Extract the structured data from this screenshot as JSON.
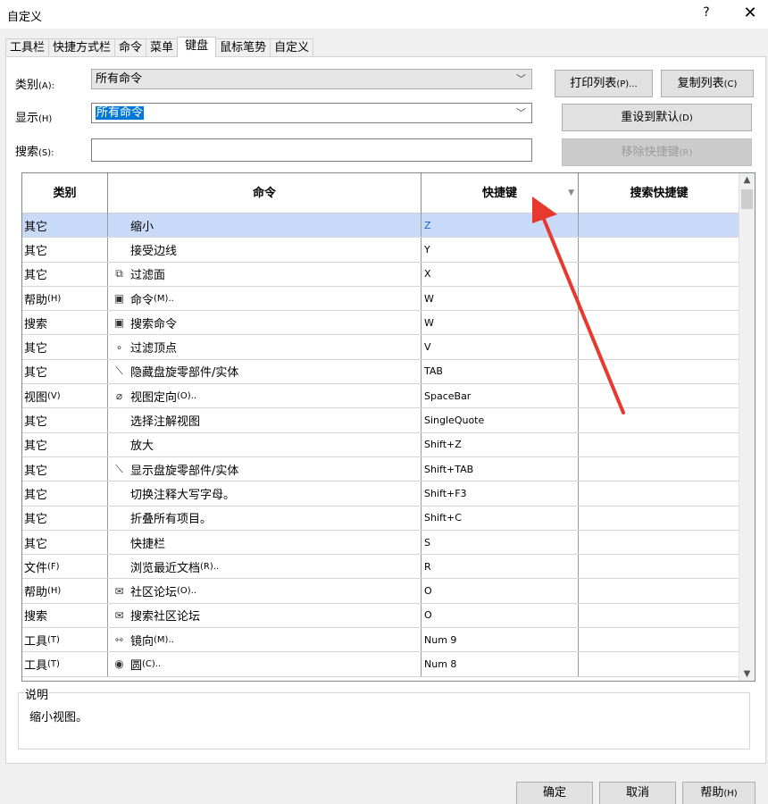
{
  "window": {
    "title": "自定义",
    "help_glyph": "?",
    "close_glyph": "✕"
  },
  "tabs": [
    {
      "label": "工具栏",
      "active": false
    },
    {
      "label": "快捷方式栏",
      "active": false
    },
    {
      "label": "命令",
      "active": false
    },
    {
      "label": "菜单",
      "active": false
    },
    {
      "label": "键盘",
      "active": true
    },
    {
      "label": "鼠标笔势",
      "active": false
    },
    {
      "label": "自定义",
      "active": false
    }
  ],
  "filters": {
    "category_label": "类别",
    "category_key": "(A):",
    "category_value": "所有命令",
    "show_label": "显示",
    "show_key": "(H)",
    "show_value": "所有命令",
    "search_label": "搜索",
    "search_key": "(S):",
    "search_value": ""
  },
  "buttons": {
    "print": {
      "label": "打印列表",
      "key": "(P)..."
    },
    "copy": {
      "label": "复制列表",
      "key": "(C)"
    },
    "reset": {
      "label": "重设到默认",
      "key": "(D)"
    },
    "remove": {
      "label": "移除快捷键",
      "key": "(R)"
    }
  },
  "grid": {
    "columns": [
      "类别",
      "命令",
      "快捷键",
      "搜索快捷键"
    ],
    "rows": [
      {
        "cat": "其它",
        "cat_key": "",
        "icon": "",
        "cmd": "缩小",
        "cmd_key": "",
        "key": "Z",
        "search": ""
      },
      {
        "cat": "其它",
        "cat_key": "",
        "icon": "",
        "cmd": "接受边线",
        "cmd_key": "",
        "key": "Y",
        "search": ""
      },
      {
        "cat": "其它",
        "cat_key": "",
        "icon": "filter-face-icon",
        "cmd": "过滤面",
        "cmd_key": "",
        "key": "X",
        "search": ""
      },
      {
        "cat": "帮助",
        "cat_key": "(H)",
        "icon": "command-box-icon",
        "cmd": "命令",
        "cmd_key": "(M)..",
        "key": "W",
        "search": ""
      },
      {
        "cat": "搜索",
        "cat_key": "",
        "icon": "command-box-icon",
        "cmd": "搜索命令",
        "cmd_key": "",
        "key": "W",
        "search": ""
      },
      {
        "cat": "其它",
        "cat_key": "",
        "icon": "filter-vertex-icon",
        "cmd": "过滤顶点",
        "cmd_key": "",
        "key": "V",
        "search": ""
      },
      {
        "cat": "其它",
        "cat_key": "",
        "icon": "hide-part-icon",
        "cmd": "隐藏盘旋零部件/实体",
        "cmd_key": "",
        "key": "TAB",
        "search": ""
      },
      {
        "cat": "视图",
        "cat_key": "(V)",
        "icon": "view-orient-icon",
        "cmd": "视图定向",
        "cmd_key": "(O)..",
        "key": "SpaceBar",
        "search": ""
      },
      {
        "cat": "其它",
        "cat_key": "",
        "icon": "",
        "cmd": "选择注解视图",
        "cmd_key": "",
        "key": "SingleQuote",
        "search": ""
      },
      {
        "cat": "其它",
        "cat_key": "",
        "icon": "",
        "cmd": "放大",
        "cmd_key": "",
        "key": "Shift+Z",
        "search": ""
      },
      {
        "cat": "其它",
        "cat_key": "",
        "icon": "show-part-icon",
        "cmd": "显示盘旋零部件/实体",
        "cmd_key": "",
        "key": "Shift+TAB",
        "search": ""
      },
      {
        "cat": "其它",
        "cat_key": "",
        "icon": "",
        "cmd": "切换注释大写字母。",
        "cmd_key": "",
        "key": "Shift+F3",
        "search": ""
      },
      {
        "cat": "其它",
        "cat_key": "",
        "icon": "",
        "cmd": "折叠所有项目。",
        "cmd_key": "",
        "key": "Shift+C",
        "search": ""
      },
      {
        "cat": "其它",
        "cat_key": "",
        "icon": "",
        "cmd": "快捷栏",
        "cmd_key": "",
        "key": "S",
        "search": ""
      },
      {
        "cat": "文件",
        "cat_key": "(F)",
        "icon": "",
        "cmd": "浏览最近文档",
        "cmd_key": "(R)..",
        "key": "R",
        "search": ""
      },
      {
        "cat": "帮助",
        "cat_key": "(H)",
        "icon": "forum-icon",
        "cmd": "社区论坛",
        "cmd_key": "(O)..",
        "key": "O",
        "search": ""
      },
      {
        "cat": "搜索",
        "cat_key": "",
        "icon": "forum-icon",
        "cmd": "搜索社区论坛",
        "cmd_key": "",
        "key": "O",
        "search": ""
      },
      {
        "cat": "工具",
        "cat_key": "(T)",
        "icon": "mirror-icon",
        "cmd": "镜向",
        "cmd_key": "(M)..",
        "key": "Num 9",
        "search": ""
      },
      {
        "cat": "工具",
        "cat_key": "(T)",
        "icon": "circle-icon",
        "cmd": "圆",
        "cmd_key": "(C)..",
        "key": "Num 8",
        "search": ""
      }
    ]
  },
  "description": {
    "legend": "说明",
    "text": "缩小视图。"
  },
  "footer": {
    "ok": "确定",
    "cancel": "取消",
    "help": "帮助",
    "help_key": "(H)"
  },
  "colors": {
    "selected_row": "#c9daf8",
    "arrow": "#e8392f",
    "focus_highlight": "#0078d7"
  }
}
